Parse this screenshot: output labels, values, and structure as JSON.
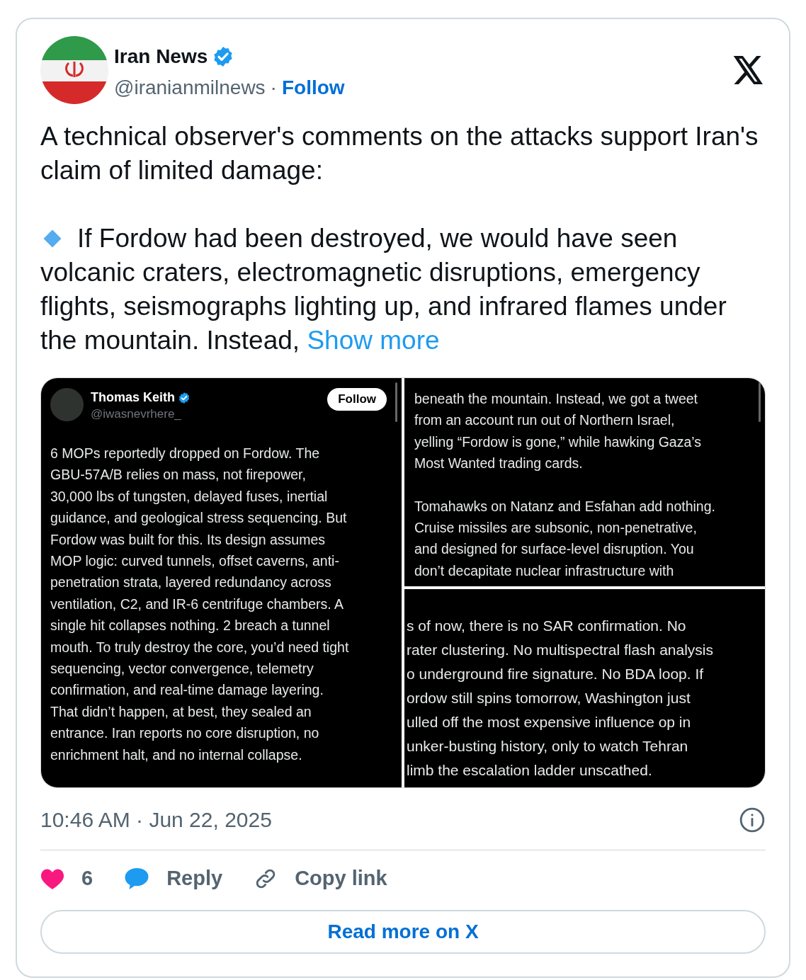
{
  "author": {
    "name": "Iran News",
    "verified": true,
    "handle": "@iranianmilnews",
    "separator": "·",
    "follow": "Follow"
  },
  "text": {
    "paragraphs": [
      {
        "bullet": false,
        "text": "A technical observer's comments on the attacks support Iran's claim of limited damage:"
      },
      {
        "bullet": true,
        "text": "If Fordow had been destroyed, we would have seen volcanic craters, electromagnetic disruptions, emergency flights, seismographs lighting up, and infrared flames under the mountain. Instead,"
      }
    ],
    "show_more": "Show more"
  },
  "media": [
    {
      "kind": "post",
      "name": "Thomas Keith",
      "verified": true,
      "handle": "@iwasnevrhere_",
      "follow": "Follow",
      "paragraphs": [
        [
          "6 MOPs reportedly dropped on Fordow. The",
          "GBU-57A/B relies on mass, not firepower,",
          "30,000 lbs of tungsten, delayed fuses, inertial",
          "guidance, and geological stress sequencing. But",
          "Fordow was built for this. Its design assumes",
          "MOP logic: curved tunnels, offset caverns, anti-",
          "penetration strata, layered redundancy across",
          "ventilation, C2, and IR-6 centrifuge chambers. A",
          "single hit collapses nothing. 2 breach a tunnel",
          "mouth. To truly destroy the core, you’d need tight",
          "sequencing, vector convergence, telemetry",
          "confirmation, and real-time damage layering.",
          "That didn’t happen, at best, they sealed an",
          "entrance. Iran reports no core disruption, no",
          "enrichment halt, and no internal collapse."
        ]
      ]
    },
    {
      "kind": "text",
      "paragraphs": [
        [
          "beneath the mountain. Instead, we got a tweet",
          "from an account run out of Northern Israel,",
          "yelling “Fordow is gone,” while hawking Gaza’s",
          "Most Wanted trading cards."
        ],
        [
          "Tomahawks on Natanz and Esfahan add nothing.",
          "Cruise missiles are subsonic, non-penetrative,",
          "and designed for surface-level disruption. You",
          "don’t decapitate nuclear infrastructure with"
        ]
      ]
    },
    {
      "kind": "large",
      "paragraphs": [
        [
          "s of now, there is no SAR confirmation. No",
          "rater clustering. No multispectral flash analysis",
          "o underground fire signature. No BDA loop. If",
          "ordow still spins tomorrow, Washington just",
          "ulled off the most expensive influence op in",
          "unker-busting history, only to watch Tehran",
          "limb the escalation ladder unscathed."
        ]
      ]
    }
  ],
  "timestamp": "10:46 AM · Jun 22, 2025",
  "actions": [
    {
      "kind": "like",
      "label": "6"
    },
    {
      "kind": "reply",
      "label": "Reply"
    },
    {
      "kind": "copy",
      "label": "Copy link"
    }
  ],
  "read_more": "Read more on X"
}
